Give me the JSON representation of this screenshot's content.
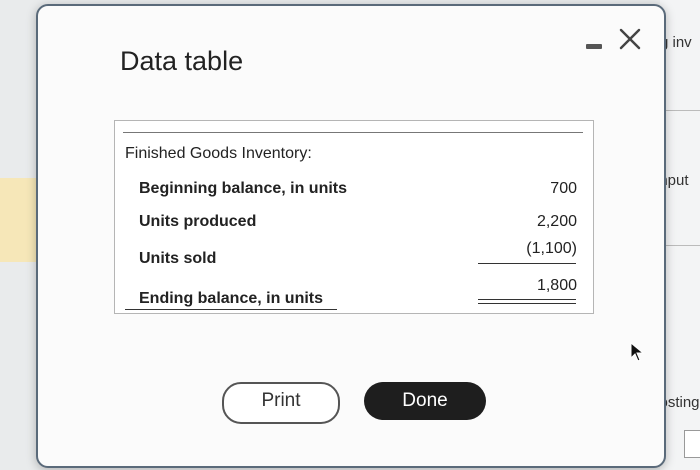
{
  "background": {
    "right_snippets": [
      "g inv",
      "input",
      "costing"
    ]
  },
  "dialog": {
    "title": "Data table"
  },
  "table": {
    "heading": "Finished Goods Inventory:",
    "rows": [
      {
        "label": "Beginning balance, in units",
        "value": "700"
      },
      {
        "label": "Units produced",
        "value": "2,200"
      },
      {
        "label": "Units sold",
        "value": "(1,100)"
      },
      {
        "label": "Ending balance, in units",
        "value": "1,800"
      }
    ]
  },
  "buttons": {
    "print_label": "Print",
    "done_label": "Done"
  },
  "colors": {
    "done_button_bg": "#1e1e1e",
    "dialog_border": "#5a6a7a"
  }
}
